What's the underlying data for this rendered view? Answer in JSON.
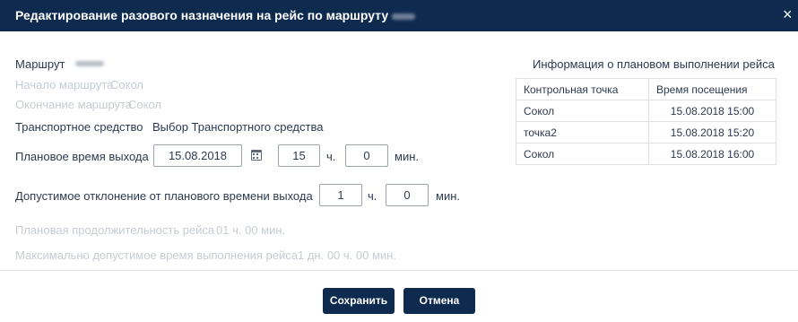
{
  "dialog": {
    "title": "Редактирование разового назначения на рейс по маршруту",
    "close_symbol": "×"
  },
  "form": {
    "route_label": "Маршрут",
    "route_start_label": "Начало маршрута",
    "route_start_value": "Сокол",
    "route_end_label": "Окончание маршрута",
    "route_end_value": "Сокол",
    "vehicle_label": "Транспортное средство",
    "vehicle_value": "Выбор Транспортного средства",
    "departure_label": "Плановое время выхода",
    "departure_date": "15.08.2018",
    "departure_hours": "15",
    "hours_unit": "ч.",
    "departure_minutes": "0",
    "minutes_unit": "мин.",
    "deviation_label": "Допустимое отклонение от планового времени выхода",
    "deviation_hours": "1",
    "deviation_minutes": "0",
    "duration_label": "Плановая продолжительность рейса",
    "duration_value": "01 ч. 00 мин.",
    "max_duration_label": "Максимально допустимое время выполнения рейса",
    "max_duration_value": "1 дн. 00 ч. 00 мин."
  },
  "info": {
    "title": "Информация о плановом выполнении рейса",
    "columns": [
      "Контрольная точка",
      "Время посещения"
    ],
    "rows": [
      {
        "point": "Сокол",
        "time": "15.08.2018 15:00"
      },
      {
        "point": "точка2",
        "time": "15.08.2018 15:20"
      },
      {
        "point": "Сокол",
        "time": "15.08.2018 16:00"
      }
    ]
  },
  "buttons": {
    "save": "Сохранить",
    "cancel": "Отмена"
  },
  "icons": {
    "close": "close-icon",
    "calendar": "calendar-icon"
  },
  "colors": {
    "header_bg": "#0e2a4f",
    "button_bg": "#0e2a4f",
    "muted_text": "#c6ccd4"
  }
}
